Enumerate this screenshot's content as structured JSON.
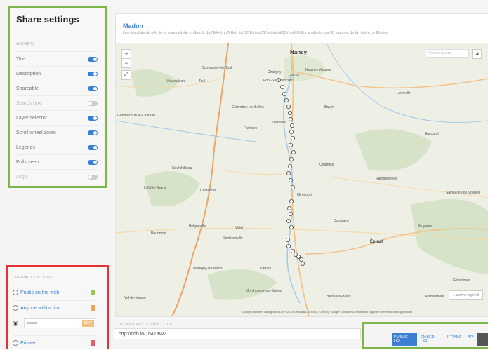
{
  "share_settings": {
    "title": "Share settings",
    "widgets_label": "WIDGETS",
    "widgets": [
      {
        "label": "Title",
        "on": true
      },
      {
        "label": "Description",
        "on": true
      },
      {
        "label": "Shareable",
        "on": true
      },
      {
        "label": "Search box",
        "on": false
      },
      {
        "label": "Layer selector",
        "on": true
      },
      {
        "label": "Scroll wheel zoom",
        "on": true
      },
      {
        "label": "Legends",
        "on": true
      },
      {
        "label": "Fullscreen",
        "on": true
      },
      {
        "label": "Logo",
        "on": false
      }
    ],
    "privacy_label": "PRIVACY OPTIONS",
    "privacy_options": [
      {
        "label": "Public on the web",
        "lock": "green"
      },
      {
        "label": "Anyone with a link",
        "lock": "orange"
      },
      {
        "label": "Private",
        "lock": "red"
      }
    ],
    "password": {
      "value": "•••••••",
      "edit_label": "EDIT"
    }
  },
  "map": {
    "title": "Madon",
    "description": "Les résultats du pH, de la conductivité (mS/cm), du NH4 (mg/NH₄), du COD (mgC/L) et du NO3 (mgNO3/L) analysés sur 30 stations de la rivière Le Madon",
    "zoom_in": "+",
    "zoom_out": "−",
    "layers_placeholder": "Visible layers",
    "legend_button": "1 active legend",
    "attribution": "Google   Données cartographiques ©2014 GeoBasis-DE/BKG (©2009), Google   Conditions d'utilisation   Signaler une erreur cartographique",
    "places": {
      "nancy": "Nancy",
      "toul": "Toul",
      "dommartin": "Dommartin-lès-Toul",
      "vaucouleurs": "Vaucouleurs",
      "chaligny": "Chaligny",
      "ludres": "Ludres",
      "pontsaintvincent": "Pont-Saint-Vincent",
      "neuvesmaisons": "Neuves-Maisons",
      "colombey": "Colombey-les-Belles",
      "favieres": "Favières",
      "vezelise": "Vézelise",
      "bayon": "Bayon",
      "charmes": "Charmes",
      "mirecourt": "Mirecourt",
      "neufchateau": "Neufchâteau",
      "chatenois": "Châtenois",
      "vittel": "Vittel",
      "contrexeville": "Contrexéville",
      "bulgneville": "Bulgnéville",
      "epinal": "Épinal",
      "dompaire": "Dompaire",
      "luneville": "Lunéville",
      "rambervillers": "Rambervillers",
      "martigny": "Martigny-les-Bains",
      "darney": "Darney",
      "monthureux": "Monthureux-sur-Saône",
      "bains": "Bains-les-Bains",
      "remiremont": "Remiremont",
      "gondrecourt": "Gondrecourt-le-Château",
      "liffol": "Liffol-le-Grand",
      "bourmont": "Bourmont",
      "valdemeuse": "Val-de-Meuse",
      "baccarat": "Baccarat",
      "saintdie": "Saint-Dié-des-Vosges",
      "bruyeres": "Bruyères",
      "gerardmer": "Gérardmer",
      "rambervillers2": "Rambervillers"
    }
  },
  "share_bar": {
    "copy_label": "COPY AND PASTE THIS CODE",
    "url": "http://cdb.io/1h41aWZ",
    "tabs": [
      "PUBLIC URL",
      "EMBED URL",
      "IFRAME",
      "API"
    ]
  }
}
